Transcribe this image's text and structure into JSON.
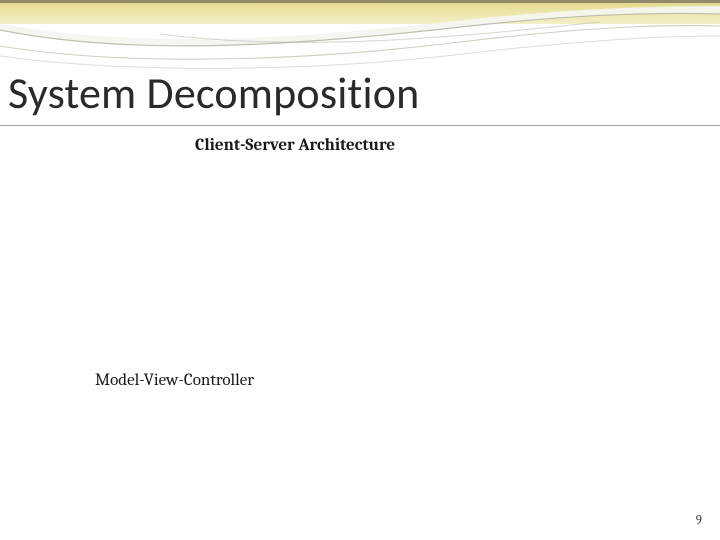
{
  "slide": {
    "title": "System Decomposition",
    "subtitle_top": "Client-Server Architecture",
    "subtitle_bottom": "Model-View-Controller",
    "page_number": "9"
  }
}
